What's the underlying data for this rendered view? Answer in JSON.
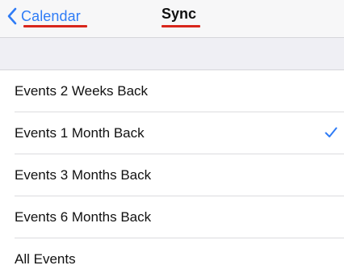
{
  "nav": {
    "back_label": "Calendar",
    "title": "Sync"
  },
  "options": [
    {
      "label": "Events 2 Weeks Back",
      "selected": false
    },
    {
      "label": "Events 1 Month Back",
      "selected": true
    },
    {
      "label": "Events 3 Months Back",
      "selected": false
    },
    {
      "label": "Events 6 Months Back",
      "selected": false
    },
    {
      "label": "All Events",
      "selected": false
    }
  ],
  "colors": {
    "accent": "#2f7cf6",
    "annotation_underline": "#d8261c",
    "nav_background": "#f7f7f8",
    "group_background": "#efeff4"
  },
  "icons": {
    "back": "chevron-left-icon",
    "selected": "checkmark-icon"
  }
}
